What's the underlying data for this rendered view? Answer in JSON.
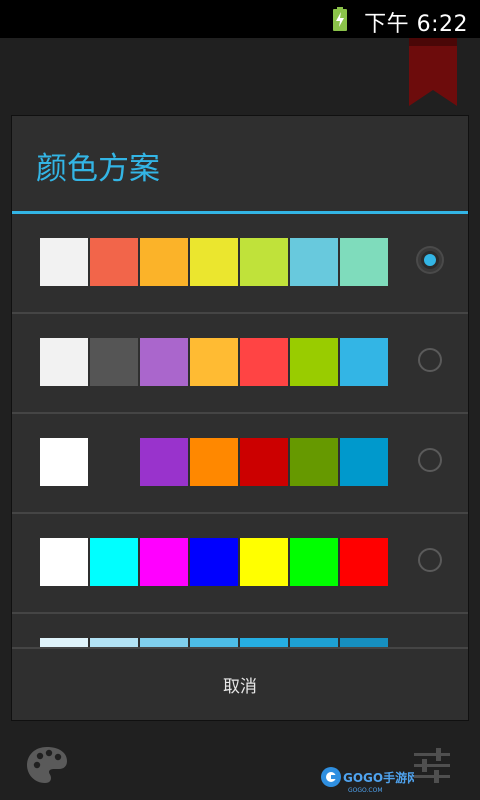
{
  "status_bar": {
    "time": "下午 6:22",
    "battery_color": "#8bc34a"
  },
  "dialog": {
    "title": "颜色方案",
    "accent_color": "#33b5e5",
    "cancel_label": "取消",
    "schemes": [
      {
        "selected": true,
        "colors": [
          "#f2f2f2",
          "#f2654a",
          "#fbb329",
          "#ebe62e",
          "#c0e23a",
          "#68c9dd",
          "#7fdcbc"
        ]
      },
      {
        "selected": false,
        "colors": [
          "#f2f2f2",
          "#555555",
          "#aa66cc",
          "#ffbb33",
          "#ff4444",
          "#99cc00",
          "#33b5e5"
        ]
      },
      {
        "selected": false,
        "colors": [
          "#ffffff",
          "#2f2f2f",
          "#9933cc",
          "#ff8800",
          "#cc0000",
          "#669900",
          "#0099cc"
        ]
      },
      {
        "selected": false,
        "colors": [
          "#ffffff",
          "#00ffff",
          "#ff00ff",
          "#0000ff",
          "#ffff00",
          "#00ff00",
          "#ff0000"
        ]
      },
      {
        "selected": false,
        "colors": [
          "#e0f4fb",
          "#b3e3f5",
          "#80d0ee",
          "#4dbde7",
          "#26aee2",
          "#1ea1d4",
          "#168fc0"
        ]
      }
    ]
  },
  "background": {
    "bookmark_color": "#7a0d0d"
  },
  "icons": {
    "battery": "battery-charging-icon",
    "bookmark": "bookmark-icon",
    "palette": "palette-icon",
    "sliders": "sliders-icon"
  },
  "watermark": {
    "text": "GOGO手游网",
    "sub": "GOGO.COM"
  }
}
